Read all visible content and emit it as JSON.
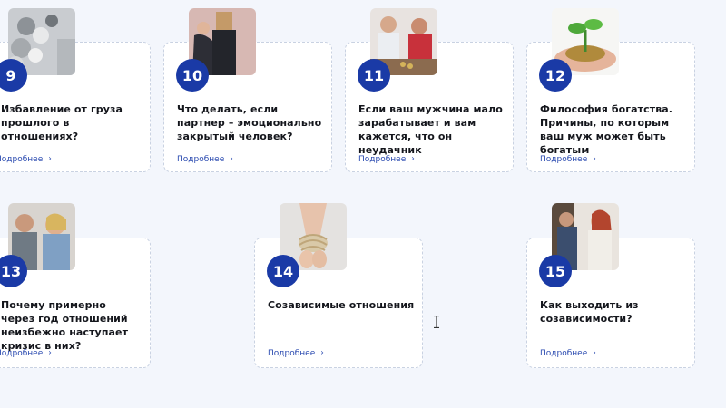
{
  "cards": [
    {
      "number": "9",
      "title": "Избавление от груза прошлого в отношениях?",
      "more": "Подробнее",
      "image": "coins-jewelry-photo"
    },
    {
      "number": "10",
      "title": "Что делать, если партнер – эмоционально закрытый человек?",
      "more": "Подробнее",
      "image": "box-head-couple-photo"
    },
    {
      "number": "11",
      "title": "Если ваш мужчина мало зарабатывает и вам кажется, что он неудачник",
      "more": "Подробнее",
      "image": "couple-counting-coins-photo"
    },
    {
      "number": "12",
      "title": "Философия богатства. Причины, по которым ваш муж может быть богатым",
      "more": "Подробнее",
      "image": "plant-in-coins-photo"
    },
    {
      "number": "13",
      "title": "Почему примерно через год отношений неизбежно наступает кризис в них?",
      "more": "Подробнее",
      "image": "upset-couple-photo"
    },
    {
      "number": "14",
      "title": "Созависимые отношения",
      "more": "Подробнее",
      "image": "tied-hands-photo"
    },
    {
      "number": "15",
      "title": "Как выходить из созависимости?",
      "more": "Подробнее",
      "image": "couple-at-door-photo"
    }
  ],
  "icons": {
    "chevron": "chevron-right-icon",
    "cursor": "text-cursor-icon"
  },
  "colors": {
    "accent": "#1a3aa6",
    "link": "#2a4ab0",
    "background": "#f3f6fc"
  }
}
